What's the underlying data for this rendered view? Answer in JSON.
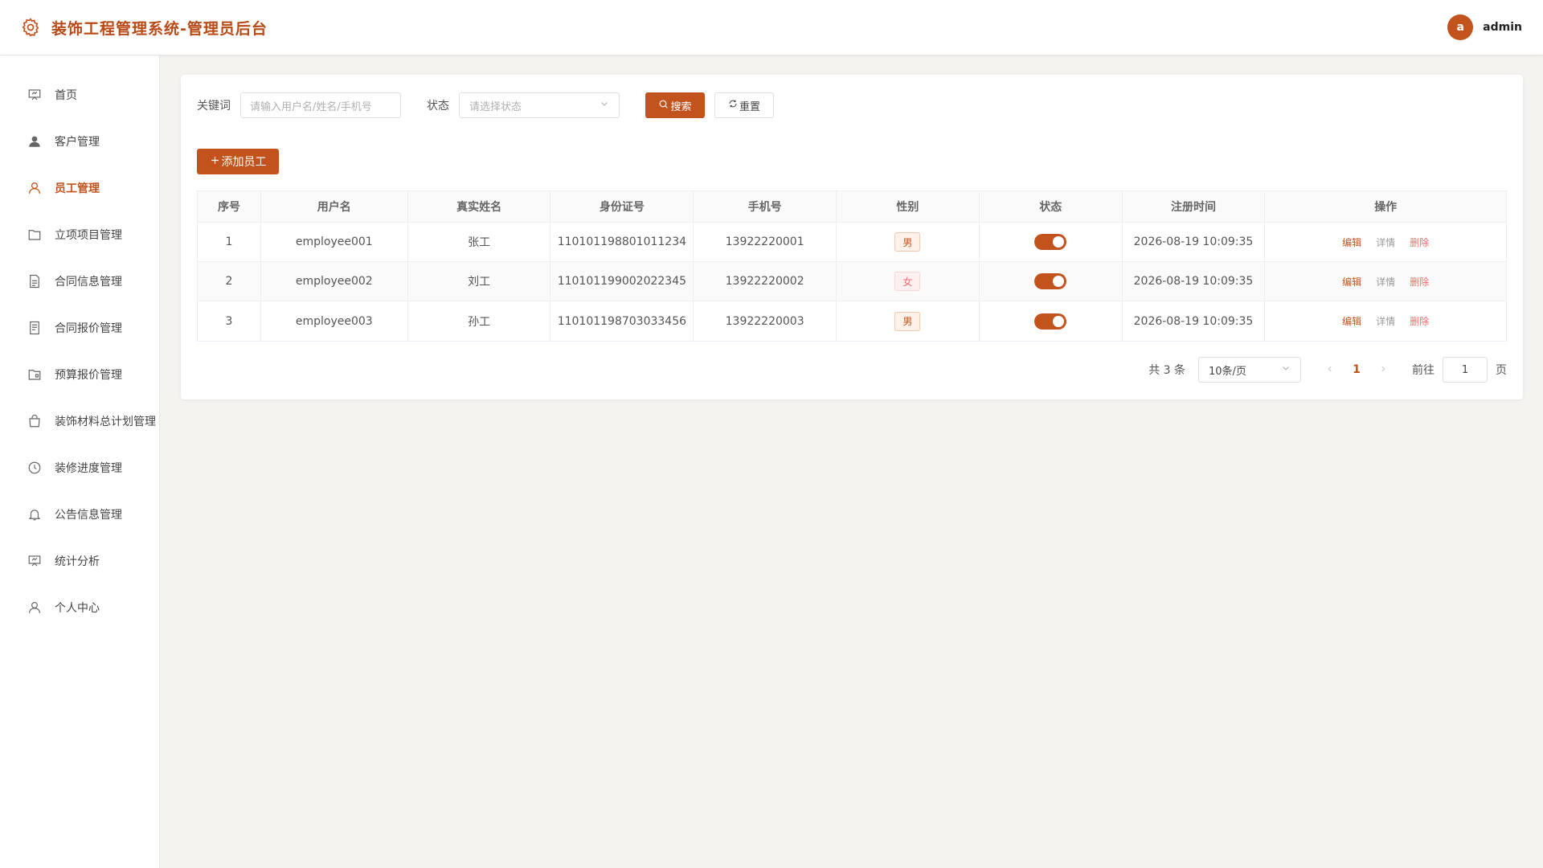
{
  "header": {
    "title": "装饰工程管理系统-管理员后台",
    "brand_icon": "gear-icon",
    "user": {
      "avatar_letter": "a",
      "name": "admin"
    }
  },
  "colors": {
    "accent": "#c2531d",
    "danger": "#f56c6c"
  },
  "sidebar": {
    "items": [
      {
        "label": "首页",
        "icon": "dashboard-icon"
      },
      {
        "label": "客户管理",
        "icon": "user-filled-icon"
      },
      {
        "label": "员工管理",
        "icon": "user-icon",
        "active": true
      },
      {
        "label": "立项项目管理",
        "icon": "folder-icon"
      },
      {
        "label": "合同信息管理",
        "icon": "document-icon"
      },
      {
        "label": "合同报价管理",
        "icon": "tickets-icon"
      },
      {
        "label": "预算报价管理",
        "icon": "folder-opened-icon"
      },
      {
        "label": "装饰材料总计划管理",
        "icon": "shopping-bag-icon"
      },
      {
        "label": "装修进度管理",
        "icon": "clock-icon"
      },
      {
        "label": "公告信息管理",
        "icon": "bell-icon"
      },
      {
        "label": "统计分析",
        "icon": "presentation-icon"
      },
      {
        "label": "个人中心",
        "icon": "user-icon"
      }
    ]
  },
  "filters": {
    "keyword_label": "关键词",
    "keyword_placeholder": "请输入用户名/姓名/手机号",
    "status_label": "状态",
    "status_placeholder": "请选择状态",
    "search_label": "搜索",
    "reset_label": "重置"
  },
  "add_button_label": "添加员工",
  "table": {
    "columns": [
      "序号",
      "用户名",
      "真实姓名",
      "身份证号",
      "手机号",
      "性别",
      "状态",
      "注册时间",
      "操作"
    ],
    "rows": [
      {
        "index": "1",
        "username": "employee001",
        "realname": "张工",
        "idcard": "110101198801011234",
        "phone": "13922220001",
        "gender": "男",
        "status_on": true,
        "registered": "2026-08-19 10:09:35"
      },
      {
        "index": "2",
        "username": "employee002",
        "realname": "刘工",
        "idcard": "110101199002022345",
        "phone": "13922220002",
        "gender": "女",
        "status_on": true,
        "registered": "2026-08-19 10:09:35"
      },
      {
        "index": "3",
        "username": "employee003",
        "realname": "孙工",
        "idcard": "110101198703033456",
        "phone": "13922220003",
        "gender": "男",
        "status_on": true,
        "registered": "2026-08-19 10:09:35"
      }
    ],
    "actions": {
      "edit": "编辑",
      "detail": "详情",
      "delete": "删除"
    }
  },
  "pagination": {
    "total_text": "共 3 条",
    "page_size": "10条/页",
    "current_page": "1",
    "goto_label": "前往",
    "goto_value": "1",
    "page_suffix": "页"
  }
}
